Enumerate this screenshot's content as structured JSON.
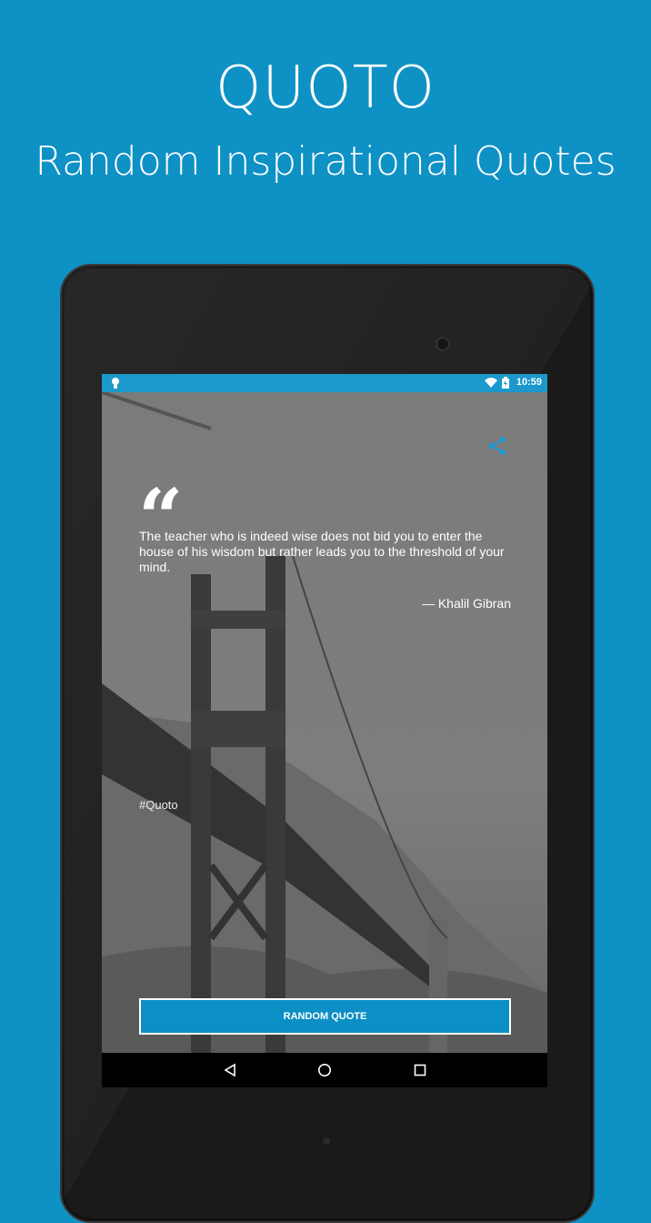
{
  "promo": {
    "title": "QUOTO",
    "subtitle": "Random Inspirational Quotes"
  },
  "status_bar": {
    "time": "10:59",
    "icons": [
      "android-icon",
      "wifi-icon",
      "battery-icon"
    ]
  },
  "quote": {
    "mark": "“",
    "text": "The teacher who is indeed wise does not bid you to enter the house of his wisdom but rather leads you to the threshold of your mind.",
    "author": "— Khalil Gibran",
    "hashtag": "#Quoto"
  },
  "actions": {
    "random_quote": "RANDOM QUOTE",
    "share_icon": "share-icon"
  },
  "nav_bar": {
    "icons": [
      "back-icon",
      "home-icon",
      "recents-icon"
    ]
  },
  "colors": {
    "background": "#0e91c5",
    "accent": "#0c8fc4",
    "share": "#1a9ad6"
  }
}
